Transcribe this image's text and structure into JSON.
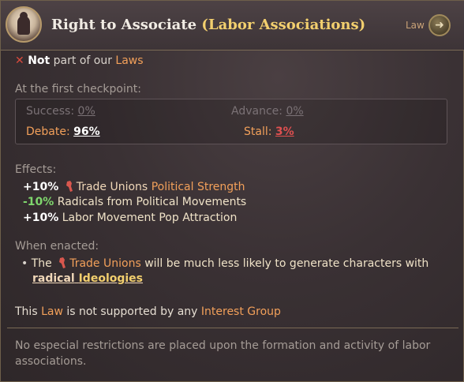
{
  "header": {
    "title_main": "Right to Associate",
    "title_group": "(Labor Associations)",
    "tag": "Law",
    "go_glyph": "➜"
  },
  "status": {
    "icon": "✕",
    "not_word": "Not",
    "rest": " part of our ",
    "laws_link": "Laws"
  },
  "checkpoint": {
    "heading": "At the first checkpoint:",
    "success_label": "Success:",
    "success_value": "0%",
    "advance_label": "Advance:",
    "advance_value": "0%",
    "debate_label": "Debate:",
    "debate_value": "96%",
    "stall_label": "Stall:",
    "stall_value": "3%"
  },
  "effects": {
    "heading": "Effects:",
    "e1_value": "+10%",
    "e1_subject": "Trade Unions",
    "e1_attr": "Political Strength",
    "e2_value": "-10%",
    "e2_text": "Radicals from Political Movements",
    "e3_value": "+10%",
    "e3_text": "Labor Movement Pop Attraction"
  },
  "enacted": {
    "heading": "When enacted:",
    "bullet": "•",
    "the": "The",
    "group": "Trade Unions",
    "text": "will be much less likely to generate characters with",
    "radical": "radical",
    "ideologies": "Ideologies"
  },
  "support": {
    "this": "This",
    "law": "Law",
    "mid": "is not supported by any",
    "ig": "Interest Group"
  },
  "description": "No especial restrictions are placed upon the formation and activity of labor associations.",
  "colors": {
    "accent_orange": "#f2a05a",
    "title_yellow": "#f2cf6e",
    "positive_green": "#7fd66d",
    "negative_red": "#e05050"
  },
  "icons": {
    "law_portrait": "law-portrait-icon",
    "go": "arrow-right-icon",
    "not_mark": "red-x-icon",
    "trade_union": "trade-union-fist-icon"
  }
}
